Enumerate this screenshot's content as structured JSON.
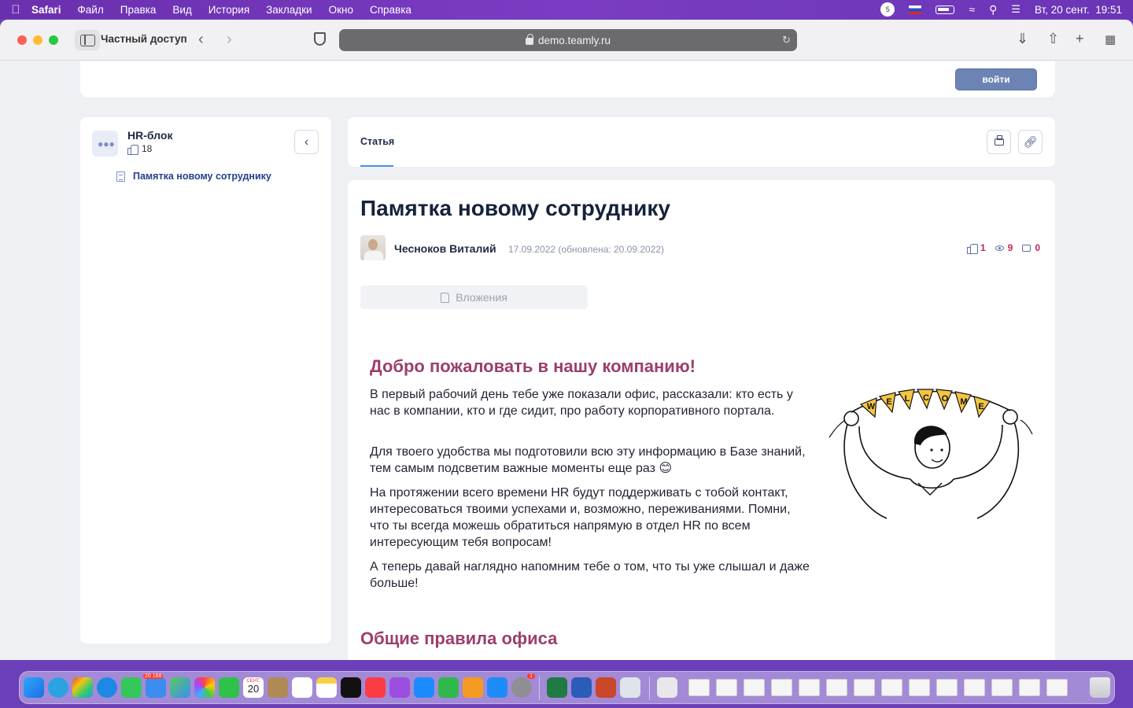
{
  "menubar": {
    "app": "Safari",
    "items": [
      "Файл",
      "Правка",
      "Вид",
      "История",
      "Закладки",
      "Окно",
      "Справка"
    ],
    "notification_count": "5",
    "datetime": "Вт, 20 сент.  19:51"
  },
  "browser": {
    "private_label": "Частный доступ",
    "url": "demo.teamly.ru"
  },
  "header": {
    "login_label": "войти"
  },
  "space": {
    "title": "HR-блок",
    "likes": "18",
    "tree_item": "Памятка новому сотруднику"
  },
  "tabs": {
    "article": "Статья"
  },
  "article": {
    "title": "Памятка новому сотруднику",
    "author": "Чесноков Виталий",
    "date": "17.09.2022 (обновлена: 20.09.2022)",
    "likes": "1",
    "views": "9",
    "comments": "0",
    "attachments_label": "Вложения",
    "welcome_heading": "Добро пожаловать в нашу компанию!",
    "paragraphs": [
      "В первый рабочий день тебе уже показали офис, рассказали: кто есть у нас в компании, кто и где сидит, про работу корпоративного портала.",
      "Для твоего удобства мы подготовили всю эту информацию в Базе знаний, тем самым подсветим важные моменты еще раз 😊",
      "На протяжении всего времени HR будут поддерживать с тобой контакт, интересоваться твоими успехами и, возможно, переживаниями. Помни, что ты всегда можешь обратиться напрямую в отдел HR по всем интересующим тебя вопросам!",
      "А теперь давай наглядно напомним тебе о том, что ты уже слышал и даже больше!"
    ],
    "section_heading": "Общие правила офиса",
    "banner_letters": [
      "W",
      "E",
      "L",
      "C",
      "O",
      "M",
      "E"
    ]
  },
  "dock": {
    "mail_badge": "20 168",
    "calendar_month": "СЕНТ.",
    "calendar_day": "20",
    "settings_badge": "1"
  },
  "colors": {
    "accent_heading": "#9b3e6d",
    "link": "#24418a",
    "stat": "#c0265a",
    "login_button": "#6c84b3",
    "banner_yellow": "#f5c542"
  }
}
